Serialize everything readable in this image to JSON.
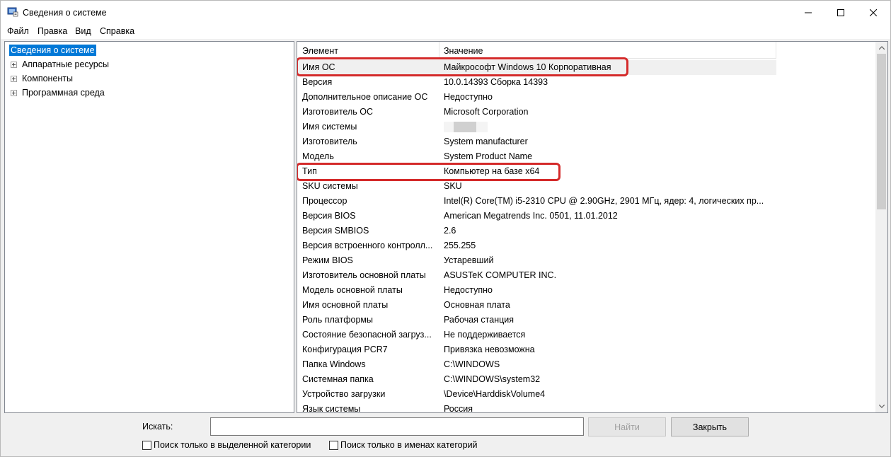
{
  "window": {
    "title": "Сведения о системе"
  },
  "menu": {
    "items": [
      "Файл",
      "Правка",
      "Вид",
      "Справка"
    ]
  },
  "tree": {
    "root": "Сведения о системе",
    "children": [
      "Аппаратные ресурсы",
      "Компоненты",
      "Программная среда"
    ]
  },
  "list": {
    "headers": {
      "name": "Элемент",
      "value": "Значение"
    },
    "rows": [
      {
        "name": "Имя ОС",
        "value": "Майкрософт Windows 10 Корпоративная"
      },
      {
        "name": "Версия",
        "value": "10.0.14393 Сборка 14393"
      },
      {
        "name": "Дополнительное описание ОС",
        "value": "Недоступно"
      },
      {
        "name": "Изготовитель ОС",
        "value": "Microsoft Corporation"
      },
      {
        "name": "Имя системы",
        "value": ""
      },
      {
        "name": "Изготовитель",
        "value": "System manufacturer"
      },
      {
        "name": "Модель",
        "value": "System Product Name"
      },
      {
        "name": "Тип",
        "value": "Компьютер на базе x64"
      },
      {
        "name": "SKU системы",
        "value": "SKU"
      },
      {
        "name": "Процессор",
        "value": "Intel(R) Core(TM) i5-2310 CPU @ 2.90GHz, 2901 МГц, ядер: 4, логических пр..."
      },
      {
        "name": "Версия BIOS",
        "value": "American Megatrends Inc. 0501, 11.01.2012"
      },
      {
        "name": "Версия SMBIOS",
        "value": "2.6"
      },
      {
        "name": "Версия встроенного контролл...",
        "value": "255.255"
      },
      {
        "name": "Режим BIOS",
        "value": "Устаревший"
      },
      {
        "name": "Изготовитель основной платы",
        "value": "ASUSTeK COMPUTER INC."
      },
      {
        "name": "Модель основной платы",
        "value": "Недоступно"
      },
      {
        "name": "Имя основной платы",
        "value": "Основная плата"
      },
      {
        "name": "Роль платформы",
        "value": "Рабочая станция"
      },
      {
        "name": "Состояние безопасной загруз...",
        "value": "Не поддерживается"
      },
      {
        "name": "Конфигурация PCR7",
        "value": "Привязка невозможна"
      },
      {
        "name": "Папка Windows",
        "value": "C:\\WINDOWS"
      },
      {
        "name": "Системная папка",
        "value": "C:\\WINDOWS\\system32"
      },
      {
        "name": "Устройство загрузки",
        "value": "\\Device\\HarddiskVolume4"
      },
      {
        "name": "Язык системы",
        "value": "Россия"
      }
    ]
  },
  "search": {
    "label": "Искать:",
    "value": "",
    "find_button": "Найти",
    "close_button": "Закрыть",
    "checkbox_selected_category": "Поиск только в выделенной категории",
    "checkbox_category_names": "Поиск только в именах категорий"
  },
  "colors": {
    "selection": "#0078d7",
    "highlight_border": "#d42a2a"
  }
}
